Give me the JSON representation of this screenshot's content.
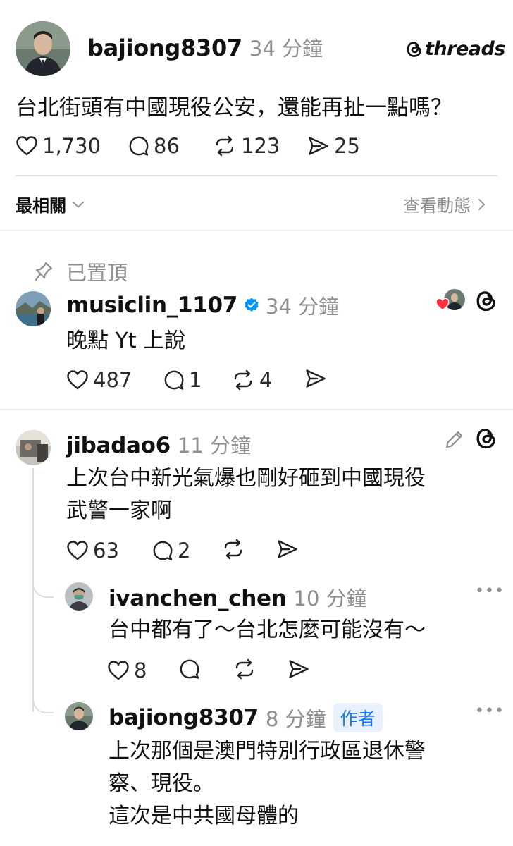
{
  "brand": {
    "name": "threads"
  },
  "post": {
    "username": "bajiong8307",
    "time": "34 分鐘",
    "text": "台北街頭有中國現役公安，還能再扯一點嗎？",
    "likes": "1,730",
    "replies": "86",
    "reposts": "123",
    "shares": "25"
  },
  "sort": {
    "label": "最相關",
    "activity_link": "查看動態"
  },
  "pinned": {
    "label": "已置頂",
    "username": "musiclin_1107",
    "time": "34 分鐘",
    "text": "晚點 Yt 上說",
    "likes": "487",
    "replies": "1",
    "reposts": "4"
  },
  "reply1": {
    "username": "jibadao6",
    "time": "11 分鐘",
    "text_line1": "上次台中新光氣爆也剛好砸到中國現役",
    "text_line2": "武警一家啊",
    "likes": "63",
    "replies": "2"
  },
  "reply2": {
    "username": "ivanchen_chen",
    "time": "10 分鐘",
    "text": "台中都有了～台北怎麼可能沒有～",
    "likes": "8"
  },
  "reply3": {
    "username": "bajiong8307",
    "time": "8 分鐘",
    "badge": "作者",
    "text_line1": "上次那個是澳門特別行政區退休警",
    "text_line2": "察、現役。",
    "text_line3": "這次是中共國母體的"
  },
  "colors": {
    "verified": "#0095f6",
    "badge_bg": "#e8f1fd",
    "badge_text": "#1877f2",
    "heart": "#ff3040",
    "muted": "#8e8e8e"
  }
}
